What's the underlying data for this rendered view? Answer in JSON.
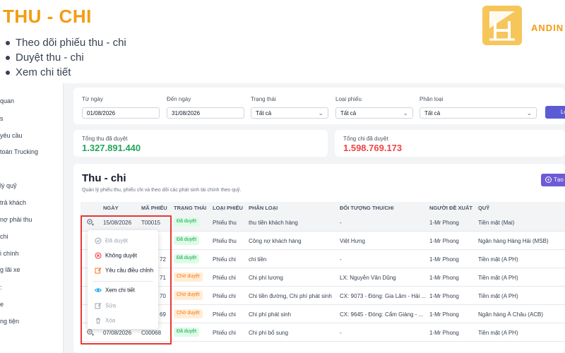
{
  "slide": {
    "title": "THU - CHI",
    "bullets": [
      "Theo dõi phiếu thu - chi",
      "Duyệt thu - chi",
      "Xem chi tiết"
    ],
    "brand": "ANDIN"
  },
  "sidebar": {
    "items": [
      "quan",
      "s",
      "yêu cầu",
      "toán Trucking",
      "lý quỹ",
      "trả khách",
      "nợ phải thu",
      "chi",
      "i chính",
      "g lãi xe",
      ":",
      "e",
      "ng tiện"
    ]
  },
  "filters": {
    "from_label": "Từ ngày",
    "from_value": "01/08/2026",
    "to_label": "Đến ngày",
    "to_value": "31/08/2026",
    "status_label": "Trạng thái",
    "status_value": "Tất cả",
    "type_label": "Loại phiếu",
    "type_value": "Tất cả",
    "category_label": "Phân loại",
    "category_value": "Tất cả",
    "filter_button": "Lo"
  },
  "stats": {
    "income_label": "Tổng thu đã duyệt",
    "income_value": "1.327.891.440",
    "income_color": "#22a55a",
    "expense_label": "Tổng chi đã duyệt",
    "expense_value": "1.598.769.173",
    "expense_color": "#ef4444"
  },
  "main": {
    "title": "Thu - chi",
    "subtitle": "Quản lý phiếu thu, phiếu chi và theo dõi các phát sinh tài chính theo quỹ.",
    "add_button": "Tạo"
  },
  "table": {
    "headers": [
      "NGÀY",
      "MÃ PHIẾU",
      "TRẠNG THÁI",
      "LOẠI PHIẾU",
      "PHÂN LOẠI",
      "ĐỐI TƯỢNG THU/CHI",
      "NGƯỜI ĐỀ XUẤT",
      "QUỸ"
    ],
    "rows": [
      {
        "date": "15/08/2026",
        "code": "T00015",
        "status": "Đã duyệt",
        "status_kind": "ok",
        "type": "Phiếu thu",
        "category": "thu tiền khách hàng",
        "party": "-",
        "proposer": "1-Mr Phong",
        "fund": "Tiền mặt (Mai)"
      },
      {
        "date": "",
        "code": "",
        "status": "Đã duyệt",
        "status_kind": "ok",
        "type": "Phiếu thu",
        "category": "Công nợ khách hàng",
        "party": "Việt Hưng",
        "proposer": "1-Mr Phong",
        "fund": "Ngân hàng Hàng Hải (MSB)"
      },
      {
        "date": "",
        "code": "72",
        "status": "Đã duyệt",
        "status_kind": "ok",
        "type": "Phiếu chi",
        "category": "chi tiền",
        "party": "-",
        "proposer": "1-Mr Phong",
        "fund": "Tiền mặt (A PH)"
      },
      {
        "date": "",
        "code": "71",
        "status": "Chờ duyệt",
        "status_kind": "wait",
        "type": "Phiếu chi",
        "category": "Chi phí lương",
        "party": "LX: Nguyễn Văn Dũng",
        "proposer": "1-Mr Phong",
        "fund": "Tiền mặt (A PH)"
      },
      {
        "date": "",
        "code": "70",
        "status": "Chờ duyệt",
        "status_kind": "wait",
        "type": "Phiếu chi",
        "category": "Chi tiền đường, Chi phí phát sinh",
        "party": "CX: 9073 - Đóng: Gia Lâm - Hải ...",
        "proposer": "1-Mr Phong",
        "fund": "Tiền mặt (A PH)"
      },
      {
        "date": "",
        "code": "69",
        "status": "Chờ duyệt",
        "status_kind": "wait",
        "type": "Phiếu chi",
        "category": "Chi phí phát sinh",
        "party": "CX: 9645 - Đóng: Cẩm Giàng - ...",
        "proposer": "1-Mr Phong",
        "fund": "Ngân hàng Á Châu (ACB)"
      },
      {
        "date": "07/08/2026",
        "code": "C00068",
        "status": "Đã duyệt",
        "status_kind": "ok",
        "type": "Phiếu chi",
        "category": "Chi phí bổ sung",
        "party": "-",
        "proposer": "1-Mr Phong",
        "fund": "Tiền mặt (A PH)"
      }
    ]
  },
  "context_menu": {
    "approved": "Đã duyệt",
    "reject": "Không duyệt",
    "request_adjust": "Yêu cầu điều chỉnh",
    "view_detail": "Xem chi tiết",
    "edit": "Sửa",
    "delete": "Xóa"
  }
}
